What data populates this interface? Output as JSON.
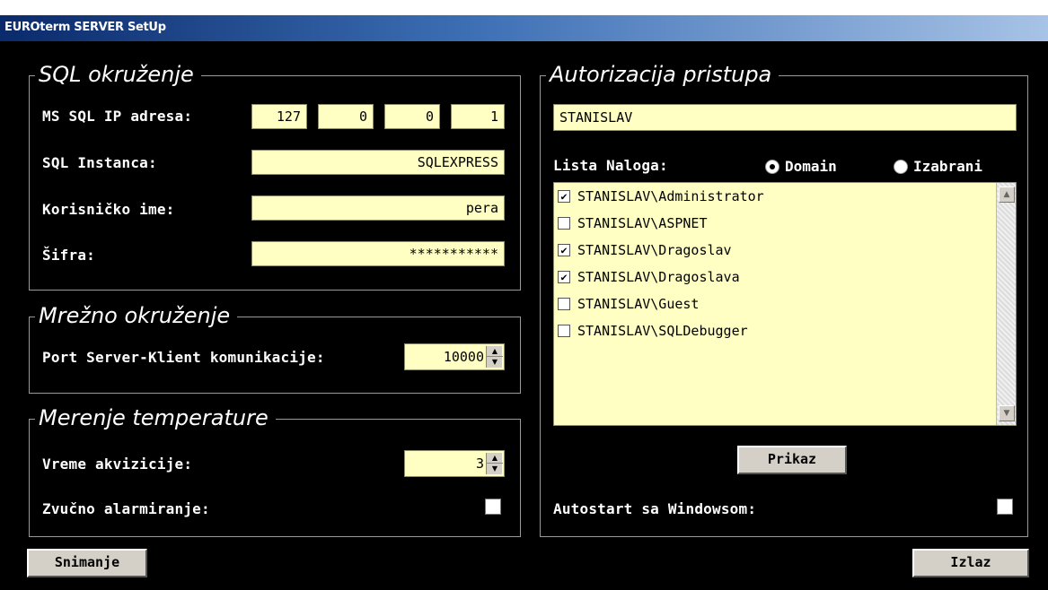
{
  "window": {
    "title": "EUROterm SERVER SetUp"
  },
  "sql": {
    "legend": "SQL okruženje",
    "ip_label": "MS SQL IP adresa:",
    "ip": [
      "127",
      "0",
      "0",
      "1"
    ],
    "instance_label": "SQL Instanca:",
    "instance": "SQLEXPRESS",
    "user_label": "Korisničko ime:",
    "user": "pera",
    "password_label": "Šifra:",
    "password": "***********"
  },
  "network": {
    "legend": "Mrežno okruženje",
    "port_label": "Port Server-Klient komunikacije:",
    "port": "10000"
  },
  "temperature": {
    "legend": "Merenje temperature",
    "acq_label": "Vreme akvizicije:",
    "acq": "3",
    "alarm_label": "Zvučno alarmiranje:"
  },
  "auth": {
    "legend": "Autorizacija pristupa",
    "domain_value": "STANISLAV",
    "list_label": "Lista Naloga:",
    "radio_domain": "Domain",
    "radio_selected": "Izabrani",
    "accounts": [
      {
        "name": "STANISLAV\\Administrator",
        "checked": true
      },
      {
        "name": "STANISLAV\\ASPNET",
        "checked": false
      },
      {
        "name": "STANISLAV\\Dragoslav",
        "checked": true
      },
      {
        "name": "STANISLAV\\Dragoslava",
        "checked": true
      },
      {
        "name": "STANISLAV\\Guest",
        "checked": false
      },
      {
        "name": "STANISLAV\\SQLDebugger",
        "checked": false
      }
    ],
    "show_button": "Prikaz",
    "autostart_label": "Autostart sa Windowsom:"
  },
  "buttons": {
    "save": "Snimanje",
    "exit": "Izlaz"
  }
}
